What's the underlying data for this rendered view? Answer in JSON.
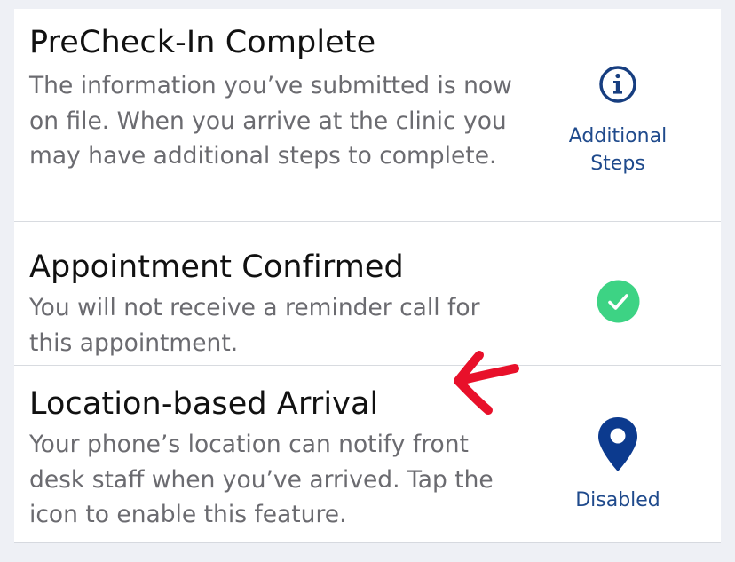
{
  "rows": [
    {
      "title": "PreCheck-In Complete",
      "description": "The information you’ve submitted is now on file. When you arrive at the clinic you may have additional steps to complete.",
      "action_label": "Additional Steps",
      "icon": "info-circle-icon"
    },
    {
      "title": "Appointment Confirmed",
      "description": "You will not receive a reminder call for this appointment.",
      "icon": "check-circle-icon"
    },
    {
      "title": "Location-based Arrival",
      "description": "Your phone’s location can notify front desk staff when you’ve arrived. Tap the icon to enable this feature.",
      "action_label": "Disabled",
      "icon": "map-pin-icon"
    }
  ],
  "colors": {
    "page_background": "#eef0f5",
    "card_background": "#ffffff",
    "title_text": "#111111",
    "description_text": "#6b6b70",
    "accent_blue": "#1f4a8c",
    "pin_navy": "#0c3a8e",
    "success_green": "#3dd384",
    "annotation_red": "#e8102a"
  }
}
